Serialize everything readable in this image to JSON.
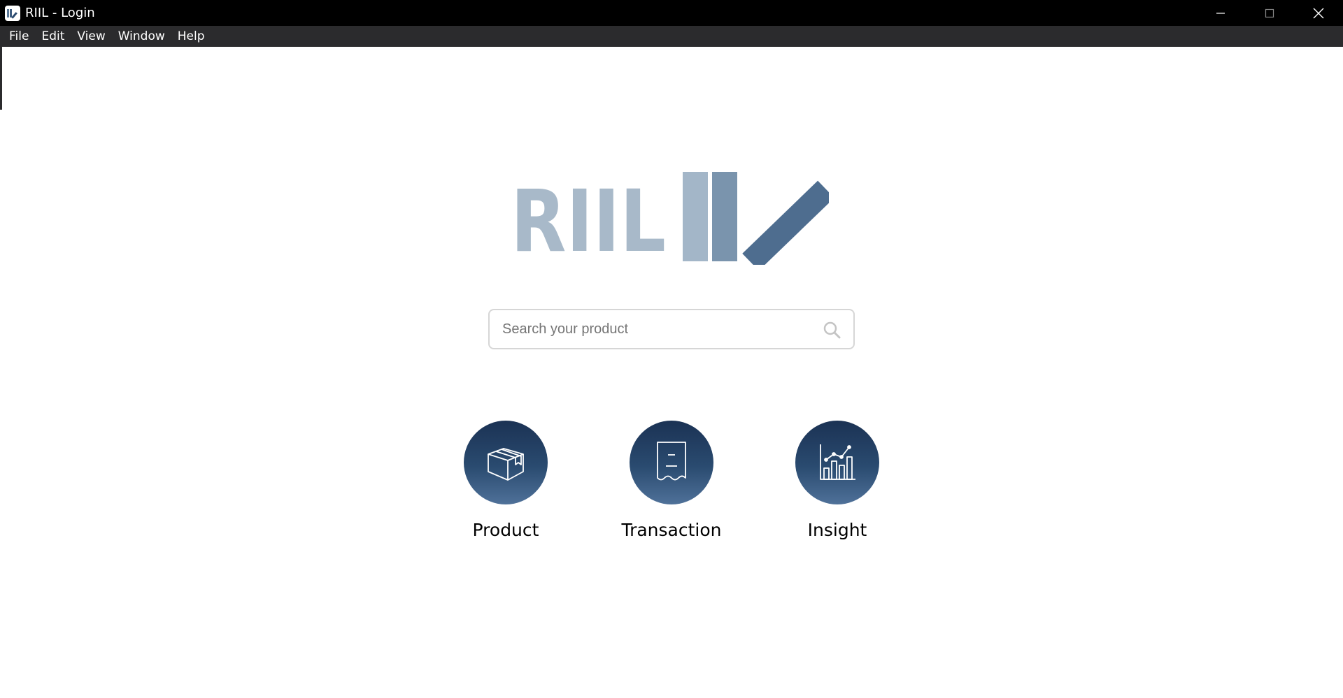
{
  "window": {
    "title": "RIIL - Login",
    "controls": [
      "minimize-icon",
      "maximize-icon",
      "close-icon"
    ]
  },
  "menubar": {
    "items": [
      {
        "label": "File"
      },
      {
        "label": "Edit"
      },
      {
        "label": "View"
      },
      {
        "label": "Window"
      },
      {
        "label": "Help"
      }
    ]
  },
  "logo": {
    "text": "RIIL",
    "colors": {
      "text": "#a8b9c9",
      "bar_light": "#a3b6c8",
      "bar_mid": "#7a94ad",
      "slash": "#4e6d8f"
    }
  },
  "search": {
    "placeholder": "Search your product",
    "value": "",
    "icon": "search-icon"
  },
  "actions": [
    {
      "label": "Product",
      "icon": "box-icon"
    },
    {
      "label": "Transaction",
      "icon": "receipt-icon"
    },
    {
      "label": "Insight",
      "icon": "chart-icon"
    }
  ],
  "colors": {
    "titlebar": "#000000",
    "menubar": "#2b2b2d",
    "tile_gradient_top": "#1b3254",
    "tile_gradient_bottom": "#4f7199"
  }
}
